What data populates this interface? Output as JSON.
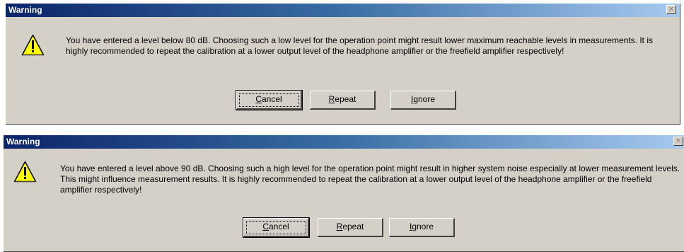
{
  "dialogs": [
    {
      "title": "Warning",
      "message": "You have entered a level below 80 dB. Choosing such a  low level for the operation point might result lower maximum reachable levels in measurements. It is highly recommended to repeat the calibration at a lower output level of the headphone amplifier or the freefield amplifier respectively!",
      "buttons": {
        "cancel": {
          "mnemonic": "C",
          "rest": "ancel"
        },
        "repeat": {
          "mnemonic": "R",
          "rest": "epeat"
        },
        "ignore": {
          "mnemonic": "I",
          "rest": "gnore"
        }
      }
    },
    {
      "title": "Warning",
      "message": "You have entered a level above 90 dB. Choosing such a  high level for the operation point might result in higher system noise especially at lower measurement levels. This might influence measurement results. It is highly recommended to repeat the calibration at a lower output level of the headphone amplifier or the freefield amplifier respectively!",
      "buttons": {
        "cancel": {
          "mnemonic": "C",
          "rest": "ancel"
        },
        "repeat": {
          "mnemonic": "R",
          "rest": "epeat"
        },
        "ignore": {
          "mnemonic": "I",
          "rest": "gnore"
        }
      }
    }
  ],
  "icons": {
    "warning": "warning-triangle-icon",
    "close": "close-icon"
  },
  "colors": {
    "titlebar_start": "#0a246a",
    "titlebar_end": "#a6caf0",
    "dialog_bg": "#d4d0c8",
    "icon_yellow": "#ffff00"
  }
}
